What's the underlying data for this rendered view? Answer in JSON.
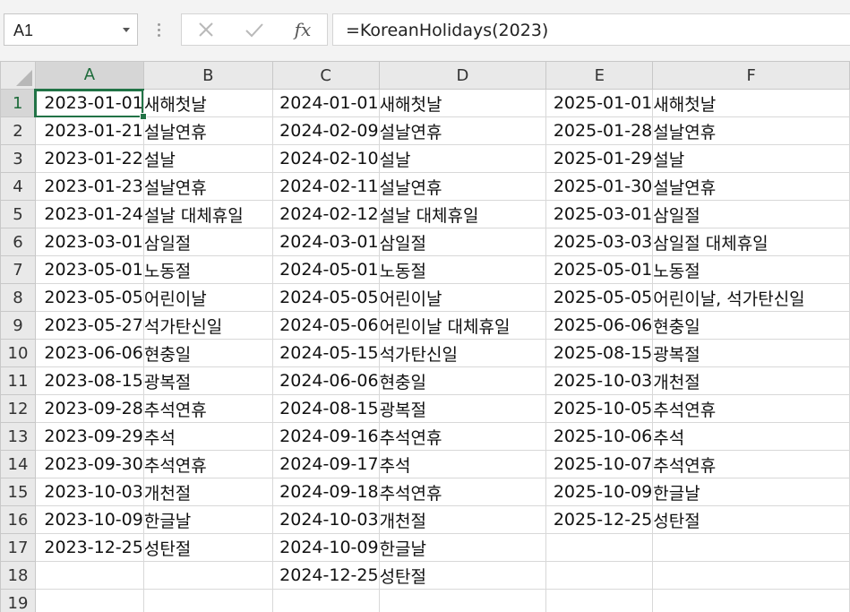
{
  "name_box": {
    "value": "A1"
  },
  "formula_bar": {
    "insert_function_label": "fx",
    "formula": "=KoreanHolidays(2023)"
  },
  "columns": [
    "A",
    "B",
    "C",
    "D",
    "E",
    "F"
  ],
  "rows": [
    {
      "num": "1",
      "a": "2023-01-01",
      "b": "새해첫날",
      "c": "2024-01-01",
      "d": "새해첫날",
      "e": "2025-01-01",
      "f": "새해첫날"
    },
    {
      "num": "2",
      "a": "2023-01-21",
      "b": "설날연휴",
      "c": "2024-02-09",
      "d": "설날연휴",
      "e": "2025-01-28",
      "f": "설날연휴"
    },
    {
      "num": "3",
      "a": "2023-01-22",
      "b": "설날",
      "c": "2024-02-10",
      "d": "설날",
      "e": "2025-01-29",
      "f": "설날"
    },
    {
      "num": "4",
      "a": "2023-01-23",
      "b": "설날연휴",
      "c": "2024-02-11",
      "d": "설날연휴",
      "e": "2025-01-30",
      "f": "설날연휴"
    },
    {
      "num": "5",
      "a": "2023-01-24",
      "b": "설날 대체휴일",
      "c": "2024-02-12",
      "d": "설날 대체휴일",
      "e": "2025-03-01",
      "f": "삼일절"
    },
    {
      "num": "6",
      "a": "2023-03-01",
      "b": "삼일절",
      "c": "2024-03-01",
      "d": "삼일절",
      "e": "2025-03-03",
      "f": "삼일절 대체휴일"
    },
    {
      "num": "7",
      "a": "2023-05-01",
      "b": "노동절",
      "c": "2024-05-01",
      "d": "노동절",
      "e": "2025-05-01",
      "f": "노동절"
    },
    {
      "num": "8",
      "a": "2023-05-05",
      "b": "어린이날",
      "c": "2024-05-05",
      "d": "어린이날",
      "e": "2025-05-05",
      "f": "어린이날, 석가탄신일"
    },
    {
      "num": "9",
      "a": "2023-05-27",
      "b": "석가탄신일",
      "c": "2024-05-06",
      "d": "어린이날 대체휴일",
      "e": "2025-06-06",
      "f": "현충일"
    },
    {
      "num": "10",
      "a": "2023-06-06",
      "b": "현충일",
      "c": "2024-05-15",
      "d": "석가탄신일",
      "e": "2025-08-15",
      "f": "광복절"
    },
    {
      "num": "11",
      "a": "2023-08-15",
      "b": "광복절",
      "c": "2024-06-06",
      "d": "현충일",
      "e": "2025-10-03",
      "f": "개천절"
    },
    {
      "num": "12",
      "a": "2023-09-28",
      "b": "추석연휴",
      "c": "2024-08-15",
      "d": "광복절",
      "e": "2025-10-05",
      "f": "추석연휴"
    },
    {
      "num": "13",
      "a": "2023-09-29",
      "b": "추석",
      "c": "2024-09-16",
      "d": "추석연휴",
      "e": "2025-10-06",
      "f": "추석"
    },
    {
      "num": "14",
      "a": "2023-09-30",
      "b": "추석연휴",
      "c": "2024-09-17",
      "d": "추석",
      "e": "2025-10-07",
      "f": "추석연휴"
    },
    {
      "num": "15",
      "a": "2023-10-03",
      "b": "개천절",
      "c": "2024-09-18",
      "d": "추석연휴",
      "e": "2025-10-09",
      "f": "한글날"
    },
    {
      "num": "16",
      "a": "2023-10-09",
      "b": "한글날",
      "c": "2024-10-03",
      "d": "개천절",
      "e": "2025-12-25",
      "f": "성탄절"
    },
    {
      "num": "17",
      "a": "2023-12-25",
      "b": "성탄절",
      "c": "2024-10-09",
      "d": "한글날",
      "e": "",
      "f": ""
    },
    {
      "num": "18",
      "a": "",
      "b": "",
      "c": "2024-12-25",
      "d": "성탄절",
      "e": "",
      "f": ""
    },
    {
      "num": "19",
      "a": "",
      "b": "",
      "c": "",
      "d": "",
      "e": "",
      "f": ""
    }
  ]
}
